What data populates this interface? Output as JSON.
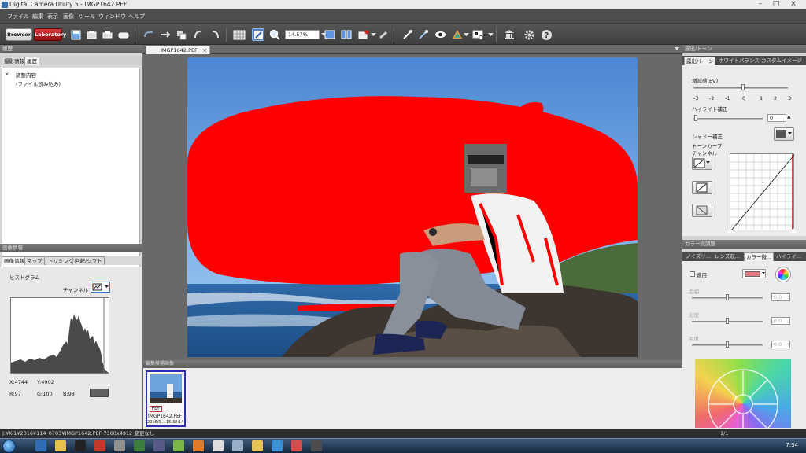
{
  "window": {
    "title": "Digital Camera Utility 5 - IMGP1642.PEF"
  },
  "menu": [
    "ファイル",
    "編集",
    "表示",
    "画像",
    "ツール",
    "ウィンドウ",
    "ヘルプ"
  ],
  "toolbar": {
    "browser_label": "Browser",
    "laboratory_label": "Laboratory",
    "zoom_value": "14.57%"
  },
  "left_top_panel": {
    "header": "履歴",
    "tabs": [
      "撮影情報",
      "履歴"
    ],
    "active_tab": "履歴",
    "rows": [
      {
        "marker": "×",
        "text": "調整内容"
      },
      {
        "marker": "",
        "text": "(ファイル読み込み)"
      }
    ]
  },
  "left_bottom_panel": {
    "header": "画像情報",
    "tabs": [
      "画像情報",
      "マップ",
      "トリミング",
      "回転/シフト"
    ],
    "active_tab": "画像情報",
    "histogram_label": "ヒストグラム",
    "channel_label": "チャンネル",
    "readout": {
      "x": "X:4744",
      "y": "Y:4902",
      "r": "R:97",
      "g": "G:100",
      "b": "B:98"
    }
  },
  "document": {
    "tab_name": "IMGP1642.PEF",
    "close_glyph": "×"
  },
  "filmstrip": {
    "header": "編集候補画像",
    "thumb_badge": "PEF",
    "thumb_name": "IMGP1642.PEF",
    "thumb_date": "2016/0... 15:38:14"
  },
  "right_top_panel": {
    "header": "露出/トーン",
    "tabs": [
      "露出/トーン",
      "ホワイトバランス",
      "カスタムイメージ"
    ],
    "active_tab": "露出/トーン",
    "ev_label": "増減感(EV)",
    "ev_ticks": [
      "-3",
      "-2",
      "-1",
      "0",
      "1",
      "2",
      "3"
    ],
    "clarity_label": "ハイライト補正",
    "clarity_value": "0",
    "shadow_label": "シャドー補正",
    "tonecurve_label": "トーンカーブ",
    "channel_label": "チャンネル"
  },
  "right_bottom_panel": {
    "header": "カラー微調整",
    "tabs": [
      "ノイズリ...",
      "レンズ収...",
      "カラー微...",
      "ハイライ..."
    ],
    "active_tab": "カラー微...",
    "apply_label": "適用",
    "slider_labels": [
      "色相",
      "彩度",
      "明度"
    ],
    "slider_values": [
      "0.0",
      "0.0",
      "0.0"
    ],
    "target_color": "#e07a80"
  },
  "status": {
    "path": "J:¥K-1¥2016¥114_0703¥IMGP1642.PEF  7360x4912  変更なし",
    "page": "1/1"
  },
  "taskbar": {
    "time": "7:34"
  },
  "colors": {
    "overlay_red": "#ff0000",
    "sky_top": "#5b8fd6",
    "accent_blue": "#2d2db0"
  }
}
